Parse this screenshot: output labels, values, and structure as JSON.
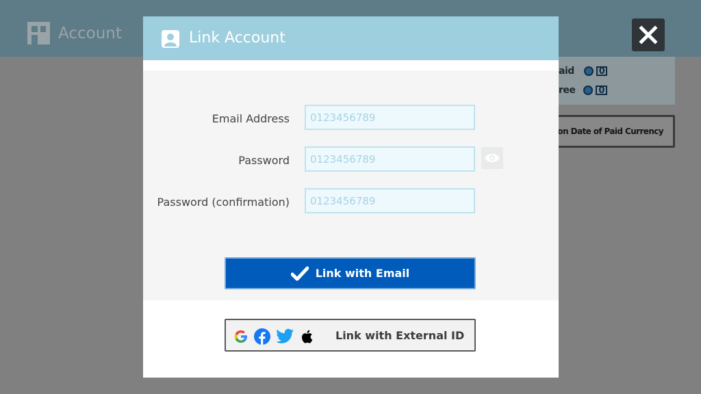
{
  "background": {
    "title": "Account",
    "rows": [
      {
        "label": "aid",
        "value": "0"
      },
      {
        "label": "ree",
        "value": "0"
      }
    ],
    "button_label": "Expiration Date of Paid Currency"
  },
  "dialog": {
    "title": "Link Account",
    "fields": [
      {
        "label": "Email Address",
        "value": "0123456789"
      },
      {
        "label": "Password",
        "value": "0123456789"
      },
      {
        "label": "Password (confirmation)",
        "value": "0123456789"
      }
    ],
    "email_button_label": "Link with Email",
    "external_button_label": "Link with External ID",
    "external_providers": [
      "google-icon",
      "facebook-icon",
      "twitter-icon",
      "apple-icon"
    ]
  },
  "colors": {
    "header": "#9ecfdf",
    "primary_button": "#005bbb",
    "input_bg": "#eef9fd"
  }
}
